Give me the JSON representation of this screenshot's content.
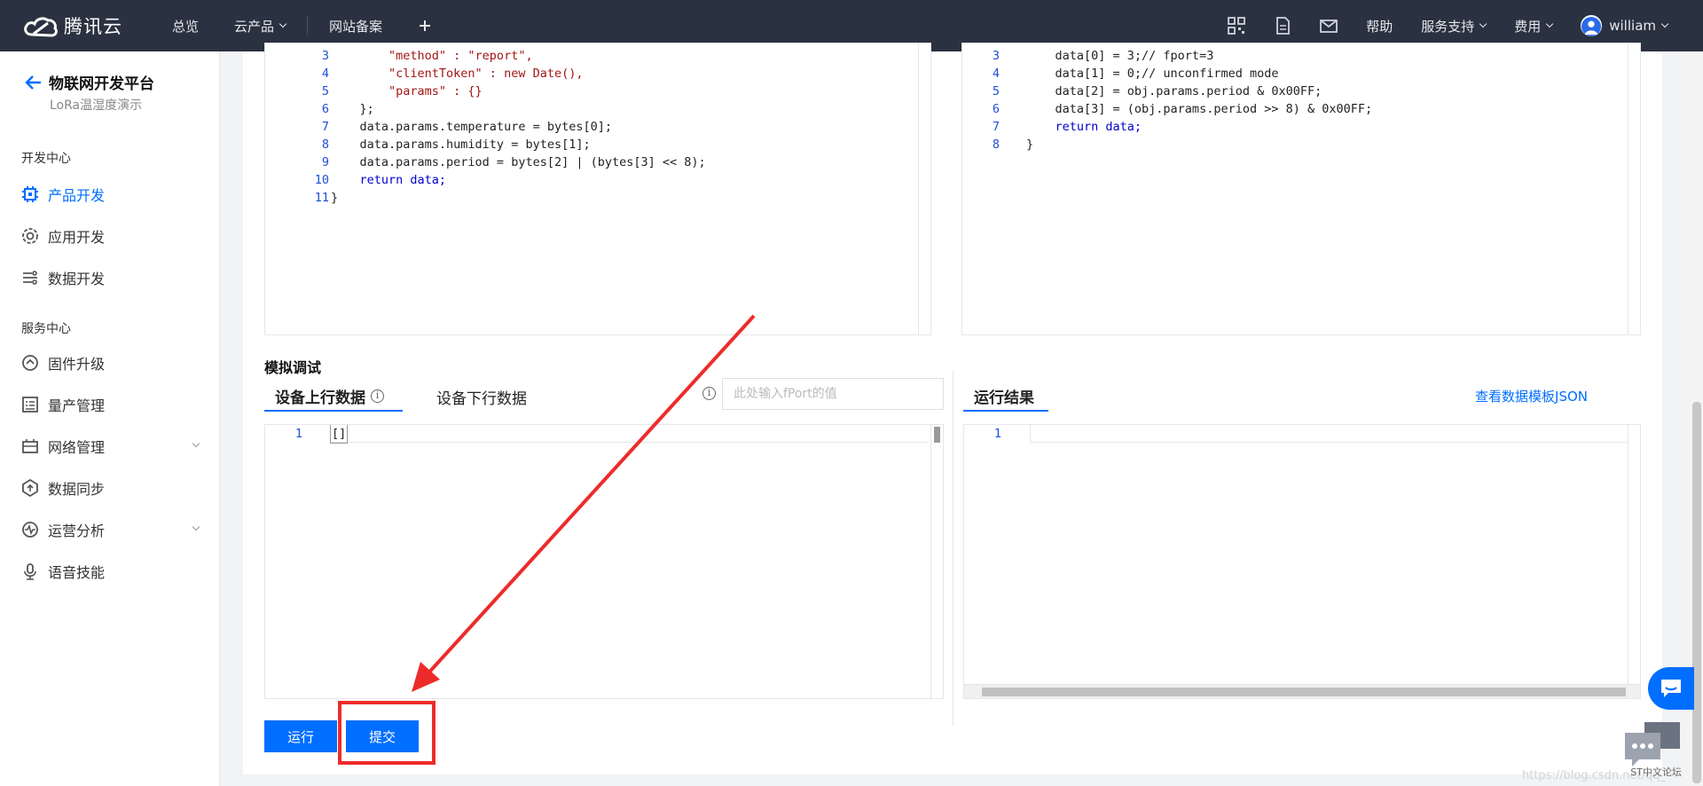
{
  "topbar": {
    "brand": "腾讯云",
    "nav": [
      {
        "label": "总览"
      },
      {
        "label": "云产品",
        "dropdown": true
      },
      {
        "label": "网站备案"
      }
    ],
    "right": {
      "help": "帮助",
      "support": "服务支持",
      "billing": "费用",
      "user": "william"
    }
  },
  "sidebar": {
    "title": "物联网开发平台",
    "subtitle": "LoRa温湿度演示",
    "groups": [
      {
        "label": "开发中心",
        "items": [
          "产品开发",
          "应用开发",
          "数据开发"
        ]
      },
      {
        "label": "服务中心",
        "items": [
          "固件升级",
          "量产管理",
          "网络管理",
          "数据同步",
          "运营分析",
          "语音技能"
        ]
      }
    ],
    "active": "产品开发"
  },
  "upstream_code": {
    "line_numbers": [
      "3",
      "4",
      "5",
      "6",
      "7",
      "8",
      "9",
      "10",
      "11"
    ],
    "lines": [
      "        \"method\" : \"report\",",
      "        \"clientToken\" : new Date(),",
      "        \"params\" : {}",
      "    };",
      "    data.params.temperature = bytes[0];",
      "    data.params.humidity = bytes[1];",
      "    data.params.period = bytes[2] | (bytes[3] << 8);",
      "    return data;",
      "}"
    ]
  },
  "downstream_code": {
    "line_numbers": [
      "3",
      "4",
      "5",
      "6",
      "7",
      "8"
    ],
    "lines": [
      "    data[0] = 3;// fport=3",
      "    data[1] = 0;// unconfirmed mode",
      "    data[2] = obj.params.period & 0x00FF;",
      "    data[3] = (obj.params.period >> 8) & 0x00FF;",
      "    return data;",
      "}"
    ]
  },
  "debug": {
    "title": "模拟调试",
    "tab_up": "设备上行数据",
    "tab_down": "设备下行数据",
    "fport_placeholder": "此处输入fPort的值",
    "input_line": "1",
    "input_value": "[]",
    "result_title": "运行结果",
    "result_line": "1",
    "json_link": "查看数据模板JSON",
    "run_label": "运行",
    "submit_label": "提交"
  },
  "watermark": "https://blog.csdn.net/qq_",
  "forum_label": "ST中文论坛",
  "colors": {
    "accent": "#006eff",
    "topbar": "#2a3140",
    "highlight": "#ee2b2b"
  }
}
